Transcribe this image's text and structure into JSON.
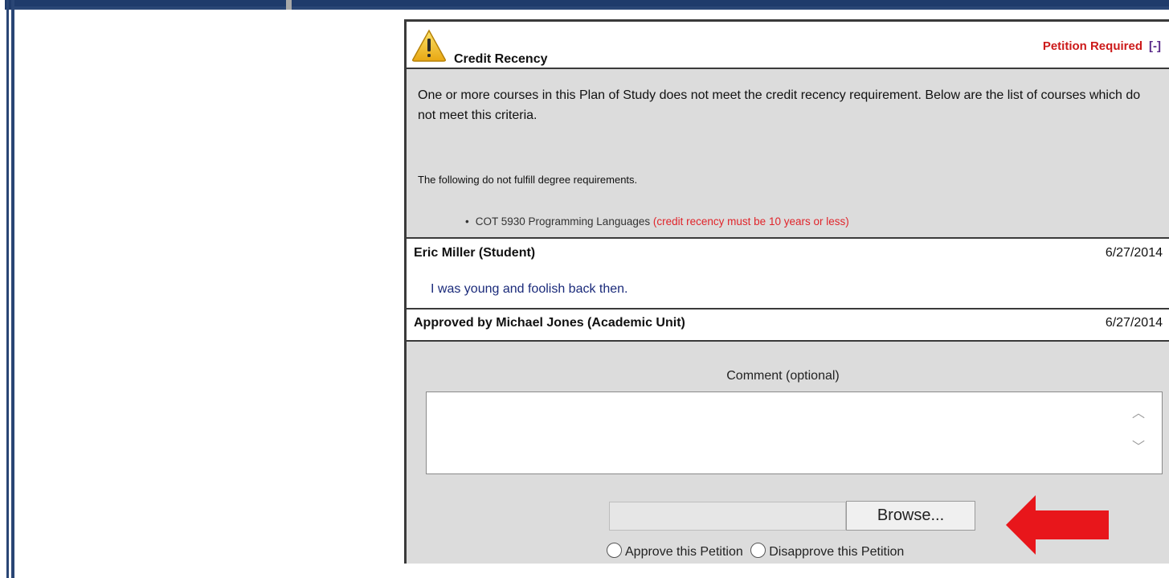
{
  "panel": {
    "title": "Credit Recency",
    "status": "Petition Required",
    "collapse_label": "[-]",
    "icon": "warning-icon",
    "status_color": "#cc1a1a"
  },
  "requirement": {
    "description": "One or more courses in this Plan of Study does not meet the credit recency requirement.  Below are the list of courses which do not meet this criteria.",
    "fulfill_text": "The following do not fulfill degree requirements.",
    "courses": [
      {
        "name": "COT 5930 Programming Languages",
        "note": "(credit recency must be 10 years or less)"
      }
    ]
  },
  "student_comment": {
    "author": "Eric Miller (Student)",
    "date": "6/27/2014",
    "text": "I was young and foolish back then."
  },
  "approval": {
    "author": "Approved by Michael Jones (Academic Unit)",
    "date": "6/27/2014"
  },
  "response_form": {
    "comment_label": "Comment (optional)",
    "comment_value": "",
    "file_path_value": "",
    "browse_label": "Browse...",
    "approve_label": "Approve this Petition",
    "disapprove_label": "Disapprove this Petition"
  },
  "annotation": {
    "arrow_color": "#e8161b",
    "icon": "red-arrow-icon"
  }
}
